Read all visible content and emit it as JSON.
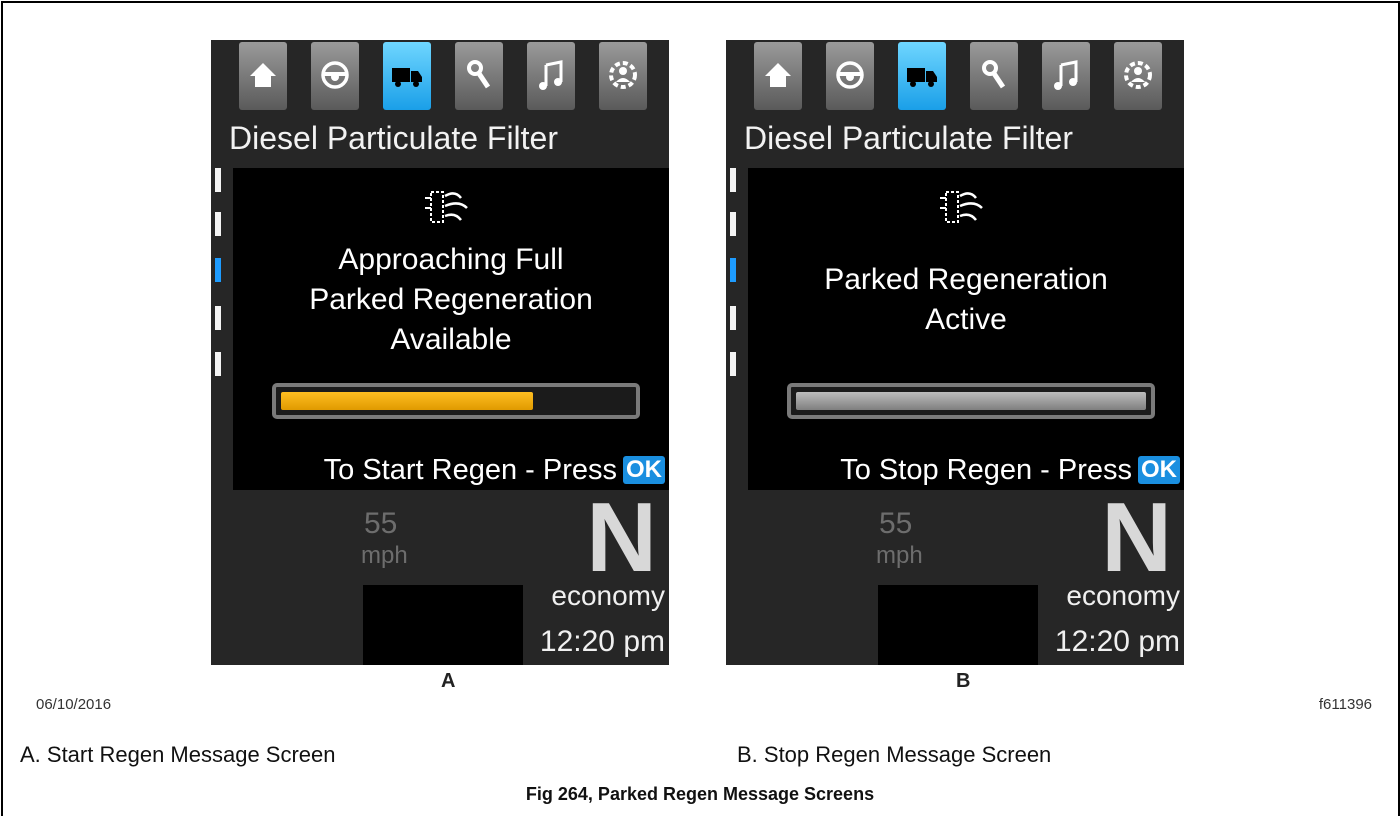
{
  "nav_tabs": [
    {
      "icon": "home-icon",
      "active": false
    },
    {
      "icon": "steering-wheel-icon",
      "active": false
    },
    {
      "icon": "truck-icon",
      "active": true
    },
    {
      "icon": "wrench-icon",
      "active": false
    },
    {
      "icon": "music-note-icon",
      "active": false
    },
    {
      "icon": "gear-settings-icon",
      "active": false
    }
  ],
  "screens": [
    {
      "letter": "A",
      "title": "Diesel Particulate Filter",
      "message_lines": [
        "Approaching Full",
        "Parked Regeneration",
        "Available"
      ],
      "progress_fraction": 0.72,
      "progress_color": "#e9a600",
      "prompt": "To Start Regen - Press",
      "ok_label": "OK",
      "speed": "55",
      "speed_unit": "mph",
      "gear": "N",
      "mode": "economy",
      "time": "12:20 pm"
    },
    {
      "letter": "B",
      "title": "Diesel Particulate Filter",
      "message_lines": [
        "Parked Regeneration",
        "Active"
      ],
      "progress_fraction": 1.0,
      "progress_color": "#9a9a9a",
      "prompt": "To Stop Regen - Press",
      "ok_label": "OK",
      "speed": "55",
      "speed_unit": "mph",
      "gear": "N",
      "mode": "economy",
      "time": "12:20 pm"
    }
  ],
  "side_indicator_active_index": 2,
  "date": "06/10/2016",
  "figure_id": "f611396",
  "captions": [
    "A.  Start Regen Message Screen",
    "B.  Stop Regen Message Screen"
  ],
  "figure_title": "Fig 264, Parked Regen Message Screens",
  "colors": {
    "accent_blue": "#1e9cff",
    "screen_bg": "#262626"
  }
}
